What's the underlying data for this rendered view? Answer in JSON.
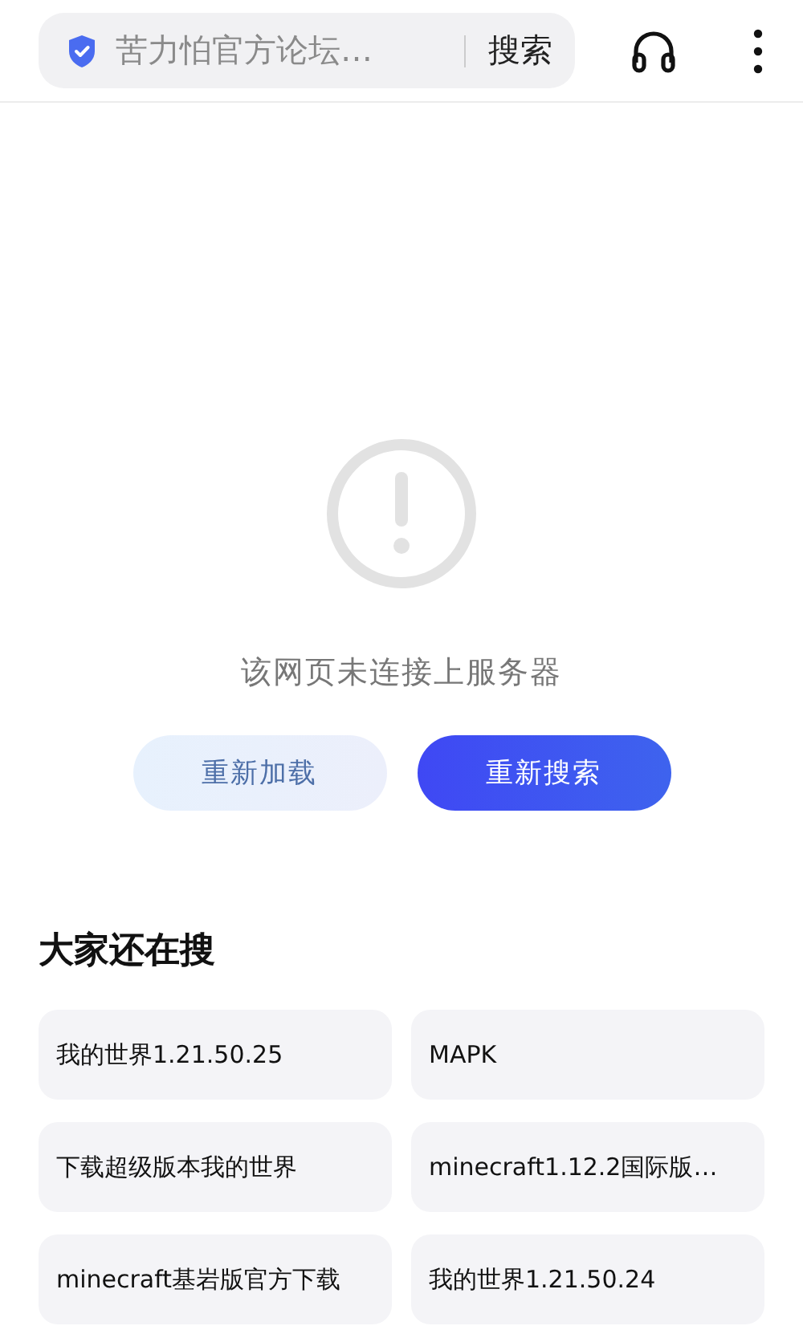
{
  "search_bar": {
    "query": "苦力怕官方论坛…",
    "button": "搜索"
  },
  "error": {
    "message": "该网页未连接上服务器",
    "buttons": [
      {
        "label": "重新加载",
        "kind": "secondary"
      },
      {
        "label": "重新搜索",
        "kind": "primary"
      }
    ]
  },
  "related": {
    "title": "大家还在搜",
    "items": [
      "我的世界1.21.50.25",
      "MAPK",
      "下载超级版本我的世界",
      "minecraft1.12.2国际版…",
      "minecraft基岩版官方下载",
      "我的世界1.21.50.24"
    ]
  }
}
